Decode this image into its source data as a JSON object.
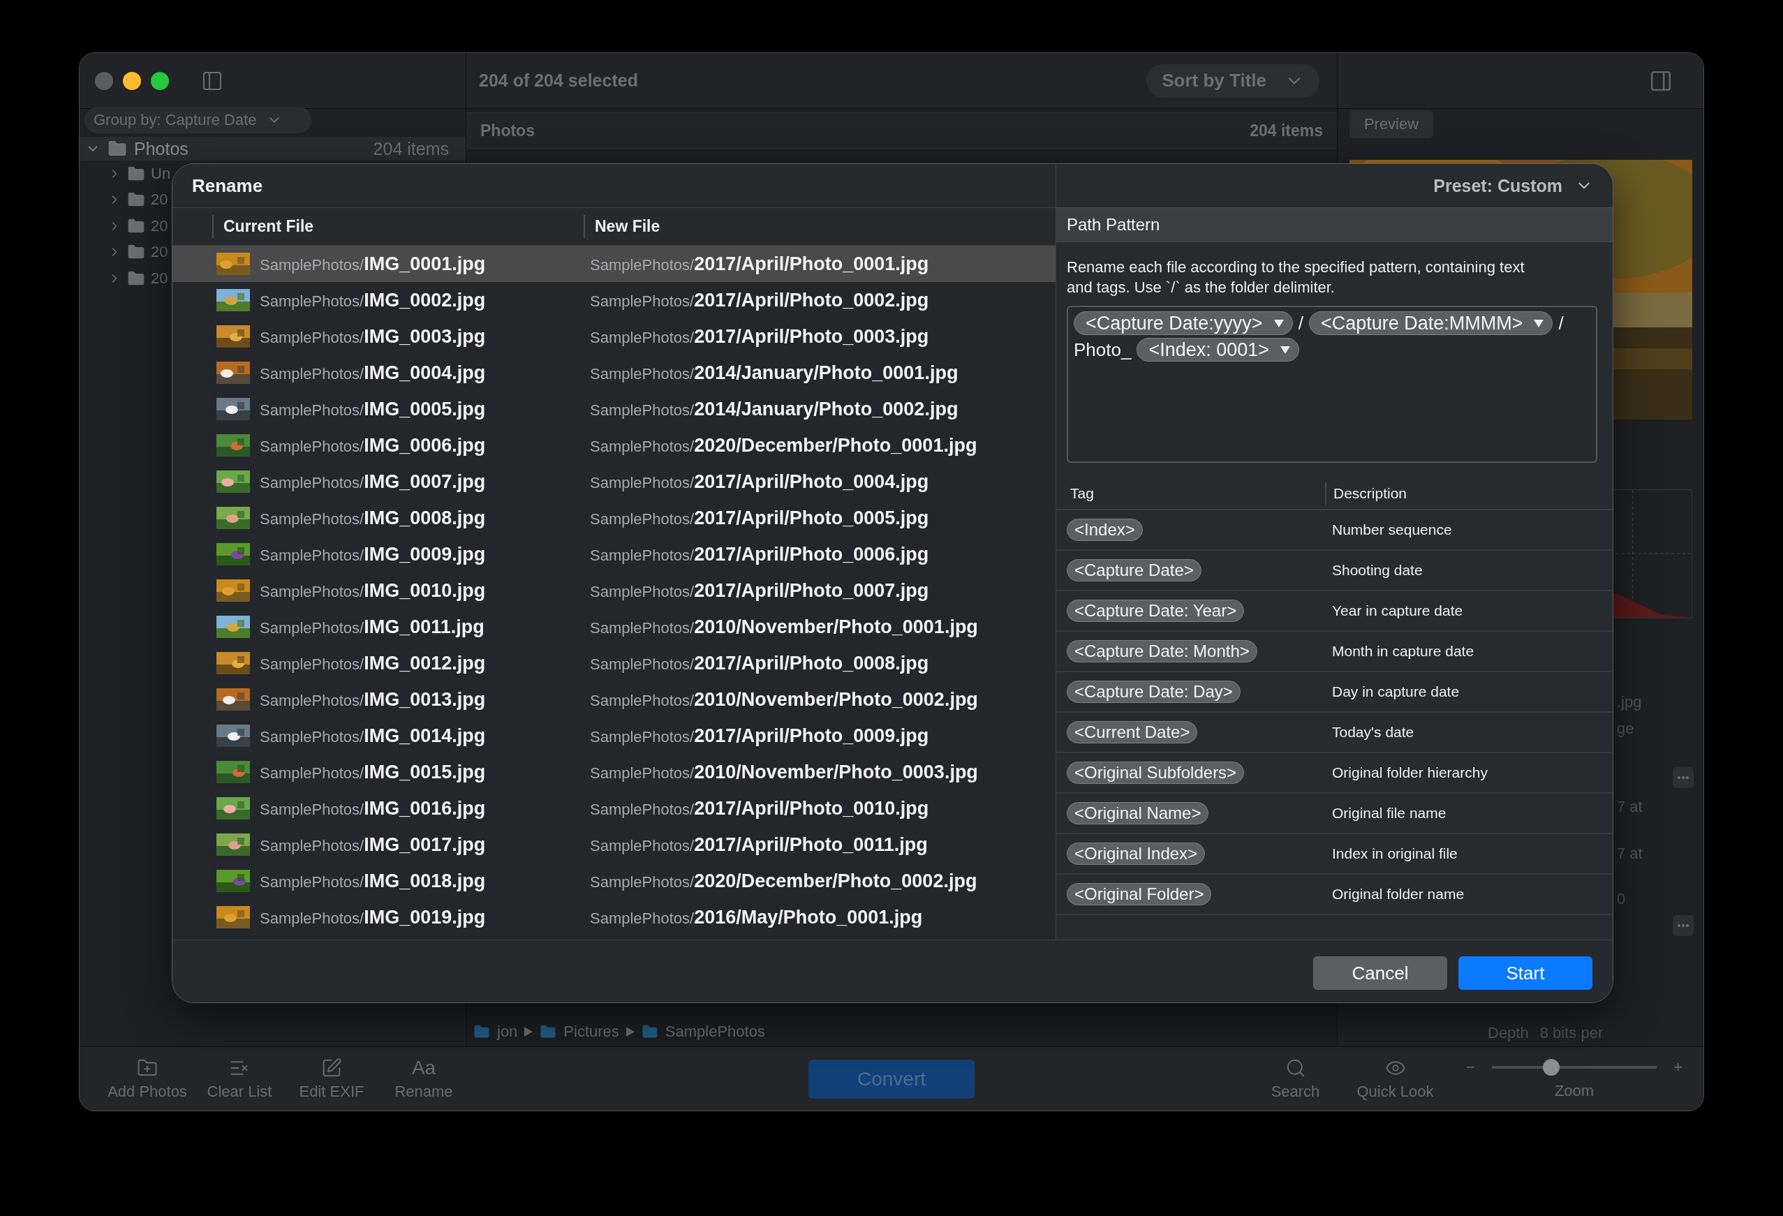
{
  "toolbar": {
    "selection_count": "204 of 204 selected",
    "sort": "Sort by Title"
  },
  "sidebar": {
    "group_by": "Group by: Capture Date",
    "root": {
      "label": "Photos",
      "count": "204 items",
      "expanded": true,
      "children": [
        {
          "label": "Un",
          "expanded": false
        },
        {
          "label": "20",
          "expanded": false
        },
        {
          "label": "20",
          "expanded": false
        },
        {
          "label": "20",
          "expanded": false
        },
        {
          "label": "20",
          "expanded": false
        }
      ]
    }
  },
  "list_header": {
    "title": "Photos",
    "count": "204 items"
  },
  "inspector": {
    "tab": "Preview",
    "fragments": [
      {
        "kind": "text",
        "text": ".jpg"
      },
      {
        "kind": "text",
        "text": "ge"
      },
      {
        "kind": "more"
      },
      {
        "kind": "text",
        "text": "7 at"
      },
      {
        "kind": "text",
        "text": "7 at"
      },
      {
        "kind": "text",
        "text": "0"
      },
      {
        "kind": "more"
      }
    ],
    "depth_label": "Depth",
    "depth_value": "8 bits per"
  },
  "path_bar": [
    "jon",
    "Pictures",
    "SamplePhotos"
  ],
  "bottom_toolbar": {
    "left": [
      {
        "kind": "add",
        "label": "Add Photos"
      },
      {
        "kind": "clear",
        "label": "Clear List"
      },
      {
        "kind": "edit",
        "label": "Edit EXIF"
      },
      {
        "kind": "rename",
        "glyph": "Aa",
        "label": "Rename"
      }
    ],
    "convert": "Convert",
    "right": [
      {
        "kind": "search",
        "label": "Search"
      },
      {
        "kind": "look",
        "label": "Quick Look"
      }
    ],
    "zoom": {
      "label": "Zoom",
      "minus": "−",
      "plus": "+",
      "level": 0.36
    }
  },
  "dialog": {
    "title": "Rename",
    "columns": [
      "Current File",
      "New File"
    ],
    "rows": [
      {
        "current_dir": "SamplePhotos/",
        "current_name": "IMG_0001.jpg",
        "new_dir": "SamplePhotos/",
        "new_name": "2017/April/Photo_0001.jpg",
        "selected": true
      },
      {
        "current_dir": "SamplePhotos/",
        "current_name": "IMG_0002.jpg",
        "new_dir": "SamplePhotos/",
        "new_name": "2017/April/Photo_0002.jpg",
        "selected": false
      },
      {
        "current_dir": "SamplePhotos/",
        "current_name": "IMG_0003.jpg",
        "new_dir": "SamplePhotos/",
        "new_name": "2017/April/Photo_0003.jpg",
        "selected": false
      },
      {
        "current_dir": "SamplePhotos/",
        "current_name": "IMG_0004.jpg",
        "new_dir": "SamplePhotos/",
        "new_name": "2014/January/Photo_0001.jpg",
        "selected": false
      },
      {
        "current_dir": "SamplePhotos/",
        "current_name": "IMG_0005.jpg",
        "new_dir": "SamplePhotos/",
        "new_name": "2014/January/Photo_0002.jpg",
        "selected": false
      },
      {
        "current_dir": "SamplePhotos/",
        "current_name": "IMG_0006.jpg",
        "new_dir": "SamplePhotos/",
        "new_name": "2020/December/Photo_0001.jpg",
        "selected": false
      },
      {
        "current_dir": "SamplePhotos/",
        "current_name": "IMG_0007.jpg",
        "new_dir": "SamplePhotos/",
        "new_name": "2017/April/Photo_0004.jpg",
        "selected": false
      },
      {
        "current_dir": "SamplePhotos/",
        "current_name": "IMG_0008.jpg",
        "new_dir": "SamplePhotos/",
        "new_name": "2017/April/Photo_0005.jpg",
        "selected": false
      },
      {
        "current_dir": "SamplePhotos/",
        "current_name": "IMG_0009.jpg",
        "new_dir": "SamplePhotos/",
        "new_name": "2017/April/Photo_0006.jpg",
        "selected": false
      },
      {
        "current_dir": "SamplePhotos/",
        "current_name": "IMG_0010.jpg",
        "new_dir": "SamplePhotos/",
        "new_name": "2017/April/Photo_0007.jpg",
        "selected": false
      },
      {
        "current_dir": "SamplePhotos/",
        "current_name": "IMG_0011.jpg",
        "new_dir": "SamplePhotos/",
        "new_name": "2010/November/Photo_0001.jpg",
        "selected": false
      },
      {
        "current_dir": "SamplePhotos/",
        "current_name": "IMG_0012.jpg",
        "new_dir": "SamplePhotos/",
        "new_name": "2017/April/Photo_0008.jpg",
        "selected": false
      },
      {
        "current_dir": "SamplePhotos/",
        "current_name": "IMG_0013.jpg",
        "new_dir": "SamplePhotos/",
        "new_name": "2010/November/Photo_0002.jpg",
        "selected": false
      },
      {
        "current_dir": "SamplePhotos/",
        "current_name": "IMG_0014.jpg",
        "new_dir": "SamplePhotos/",
        "new_name": "2017/April/Photo_0009.jpg",
        "selected": false
      },
      {
        "current_dir": "SamplePhotos/",
        "current_name": "IMG_0015.jpg",
        "new_dir": "SamplePhotos/",
        "new_name": "2010/November/Photo_0003.jpg",
        "selected": false
      },
      {
        "current_dir": "SamplePhotos/",
        "current_name": "IMG_0016.jpg",
        "new_dir": "SamplePhotos/",
        "new_name": "2017/April/Photo_0010.jpg",
        "selected": false
      },
      {
        "current_dir": "SamplePhotos/",
        "current_name": "IMG_0017.jpg",
        "new_dir": "SamplePhotos/",
        "new_name": "2017/April/Photo_0011.jpg",
        "selected": false
      },
      {
        "current_dir": "SamplePhotos/",
        "current_name": "IMG_0018.jpg",
        "new_dir": "SamplePhotos/",
        "new_name": "2020/December/Photo_0002.jpg",
        "selected": false
      },
      {
        "current_dir": "SamplePhotos/",
        "current_name": "IMG_0019.jpg",
        "new_dir": "SamplePhotos/",
        "new_name": "2016/May/Photo_0001.jpg",
        "selected": false
      }
    ],
    "preset": "Preset: Custom",
    "pattern_title": "Path Pattern",
    "pattern_help": "Rename each file according to the specified pattern, containing text and tags. Use `/` as the folder delimiter.",
    "pattern": [
      {
        "kind": "tag",
        "text": "<Capture Date:yyyy>"
      },
      {
        "kind": "text",
        "text": "/"
      },
      {
        "kind": "tag",
        "text": "<Capture Date:MMMM>"
      },
      {
        "kind": "text",
        "text": "/"
      },
      {
        "kind": "text",
        "text": "Photo_"
      },
      {
        "kind": "tag",
        "text": "<Index: 0001>"
      }
    ],
    "tag_columns": [
      "Tag",
      "Description"
    ],
    "tags": [
      {
        "tag": "<Index>",
        "description": "Number sequence"
      },
      {
        "tag": "<Capture Date>",
        "description": "Shooting date"
      },
      {
        "tag": "<Capture Date: Year>",
        "description": "Year in capture date"
      },
      {
        "tag": "<Capture Date: Month>",
        "description": "Month in capture date"
      },
      {
        "tag": "<Capture Date: Day>",
        "description": "Day in capture date"
      },
      {
        "tag": "<Current Date>",
        "description": "Today's date"
      },
      {
        "tag": "<Original Subfolders>",
        "description": "Original folder hierarchy"
      },
      {
        "tag": "<Original Name>",
        "description": "Original file name"
      },
      {
        "tag": "<Original Index>",
        "description": "Index in original file"
      },
      {
        "tag": "<Original Folder>",
        "description": "Original folder name"
      }
    ],
    "buttons": [
      {
        "kind": "secondary",
        "label": "Cancel"
      },
      {
        "kind": "primary",
        "label": "Start"
      }
    ]
  }
}
